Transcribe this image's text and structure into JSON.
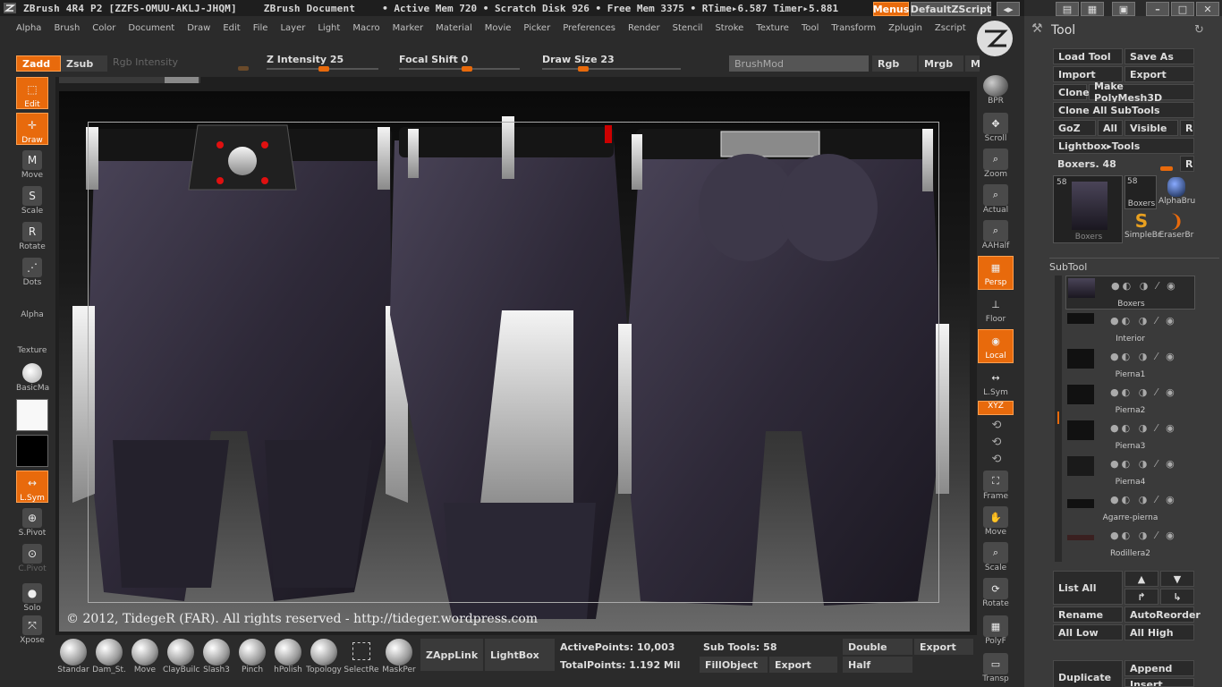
{
  "title": {
    "app": "ZBrush 4R4 P2 [ZZFS-OMUU-AKLJ-JHQM]",
    "doc": "ZBrush Document",
    "stats": "• Active Mem 720 • Scratch Disk 926 • Free Mem 3375 • RTime▸6.587 Timer▸5.881",
    "menus_btn": "Menus",
    "script_btn": "DefaultZScript"
  },
  "menubar": [
    "Alpha",
    "Brush",
    "Color",
    "Document",
    "Draw",
    "Edit",
    "File",
    "Layer",
    "Light",
    "Macro",
    "Marker",
    "Material",
    "Movie",
    "Picker",
    "Preferences",
    "Render",
    "Stencil",
    "Stroke",
    "Texture",
    "Tool",
    "Transform",
    "Zplugin",
    "Zscript"
  ],
  "brushbar": {
    "zadd": "Zadd",
    "zsub": "Zsub",
    "rgb_intensity": "Rgb Intensity",
    "z_intensity": "Z Intensity 25",
    "focal_shift": "Focal Shift 0",
    "draw_size": "Draw Size 23",
    "brushmod": "BrushMod",
    "rgb": "Rgb",
    "mrgb": "Mrgb",
    "m": "M"
  },
  "left_shelf": [
    {
      "label": "Edit",
      "on": true
    },
    {
      "label": "Draw",
      "on": true
    },
    {
      "label": "Move",
      "on": false
    },
    {
      "label": "Scale",
      "on": false
    },
    {
      "label": "Rotate",
      "on": false
    },
    {
      "label": "Dots",
      "on": false
    },
    {
      "label": "Alpha",
      "on": false
    },
    {
      "label": "Texture",
      "on": false
    },
    {
      "label": "BasicMa",
      "on": false
    },
    {
      "label": "L.Sym",
      "on": true
    },
    {
      "label": "S.Pivot",
      "on": false
    },
    {
      "label": "C.Pivot",
      "on": false
    },
    {
      "label": "Solo",
      "on": false
    },
    {
      "label": "Xpose",
      "on": false
    }
  ],
  "canvas": {
    "copyright": "© 2012, TidegeR (FAR). All rights reserved - http://tideger.wordpress.com"
  },
  "right_shelf": [
    {
      "label": "BPR",
      "on": false
    },
    {
      "label": "Scroll",
      "on": false
    },
    {
      "label": "Zoom",
      "on": false
    },
    {
      "label": "Actual",
      "on": false
    },
    {
      "label": "AAHalf",
      "on": false
    },
    {
      "label": "Persp",
      "on": true
    },
    {
      "label": "Floor",
      "on": false
    },
    {
      "label": "Local",
      "on": true
    },
    {
      "label": "L.Sym",
      "on": false
    },
    {
      "label": "XYZ",
      "on": true
    },
    {
      "label": "Frame",
      "on": false
    },
    {
      "label": "Move",
      "on": false
    },
    {
      "label": "Scale",
      "on": false
    },
    {
      "label": "Rotate",
      "on": false
    },
    {
      "label": "PolyF",
      "on": false
    },
    {
      "label": "Transp",
      "on": false
    }
  ],
  "bottom_brushes": [
    "Standar",
    "Dam_St.",
    "Move",
    "ClayBuilc",
    "Slash3",
    "Pinch",
    "hPolish",
    "Topology",
    "SelectRe",
    "MaskPer"
  ],
  "bottom": {
    "zapplink": "ZAppLink",
    "lightbox": "LightBox",
    "active_points": "ActivePoints: 10,003",
    "total_points": "TotalPoints: 1.192 Mil",
    "sub_tools": "Sub Tools: 58",
    "fill_object": "FillObject",
    "export1": "Export",
    "double": "Double",
    "export2": "Export",
    "half": "Half"
  },
  "tool_panel": {
    "title": "Tool",
    "load_tool": "Load Tool",
    "save_as": "Save As",
    "import": "Import",
    "export": "Export",
    "clone": "Clone",
    "make_polymesh": "Make PolyMesh3D",
    "clone_all": "Clone All SubTools",
    "goz": "GoZ",
    "all": "All",
    "visible": "Visible",
    "r1": "R",
    "lightbox_tools": "Lightbox▸Tools",
    "boxers_slider": "Boxers. 48",
    "r2": "R",
    "thumbs": [
      {
        "count": "58",
        "name": "Boxers"
      },
      {
        "count": "58",
        "name": "Boxers"
      },
      {
        "count": "",
        "name": "AlphaBru"
      },
      {
        "count": "",
        "name": "SimpleBr"
      },
      {
        "count": "",
        "name": "EraserBr"
      }
    ],
    "subtool_title": "SubTool",
    "subtools": [
      "Boxers",
      "Interior",
      "Pierna1",
      "Pierna2",
      "Pierna3",
      "Pierna4",
      "Agarre-pierna",
      "Rodillera2"
    ],
    "list_all": "List All",
    "rename": "Rename",
    "auto_reorder": "AutoReorder",
    "all_low": "All Low",
    "all_high": "All High",
    "duplicate": "Duplicate",
    "append": "Append",
    "insert": "Insert"
  },
  "colors": {
    "accent": "#e86a0c",
    "panel": "#3a3a3a",
    "dark": "#1e1e1e"
  }
}
